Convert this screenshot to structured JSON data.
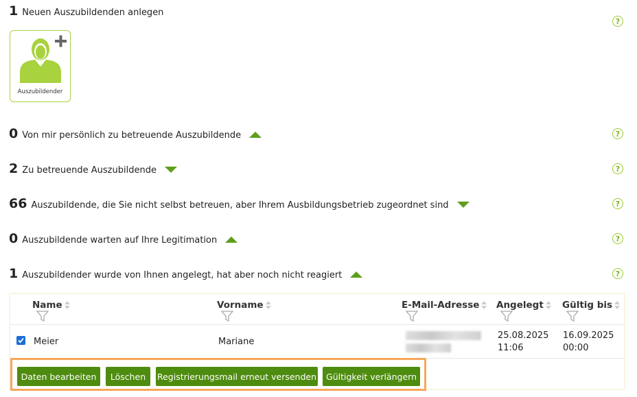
{
  "sections": [
    {
      "count": "1",
      "label": "Neuen Auszubildenden anlegen"
    },
    {
      "count": "0",
      "label": "Von mir persönlich zu betreuende Auszubildende",
      "toggle": "up"
    },
    {
      "count": "2",
      "label": "Zu betreuende Auszubildende",
      "toggle": "down"
    },
    {
      "count": "66",
      "label": "Auszubildende, die Sie nicht selbst betreuen, aber Ihrem Ausbildungsbetrieb zugeordnet sind",
      "toggle": "down"
    },
    {
      "count": "0",
      "label": "Auszubildende warten auf Ihre Legitimation",
      "toggle": "up"
    },
    {
      "count": "1",
      "label": "Auszubildender wurde von Ihnen angelegt, hat aber noch nicht reagiert",
      "toggle": "up"
    }
  ],
  "help_symbol": "?",
  "tile": {
    "label": "Auszubildender",
    "icon": "person-add-icon",
    "color": "#a8d23e"
  },
  "table": {
    "columns": [
      "Name",
      "Vorname",
      "E-Mail-Adresse",
      "Angelegt",
      "Gültig bis"
    ],
    "rows": [
      {
        "checked": true,
        "name": "Meier",
        "vorname": "Mariane",
        "email": "",
        "angelegt_date": "25.08.2025",
        "angelegt_time": "11:06",
        "gueltig_date": "16.09.2025",
        "gueltig_time": "00:00"
      }
    ]
  },
  "actions": {
    "edit": "Daten bearbeiten",
    "delete": "Löschen",
    "resend": "Registrierungsmail erneut versenden",
    "extend": "Gültigkeit verlängern"
  },
  "colors": {
    "accent": "#4e8c0f",
    "triangle": "#5f9e1b",
    "help": "#9acb2e",
    "highlight": "#f5a85a"
  }
}
